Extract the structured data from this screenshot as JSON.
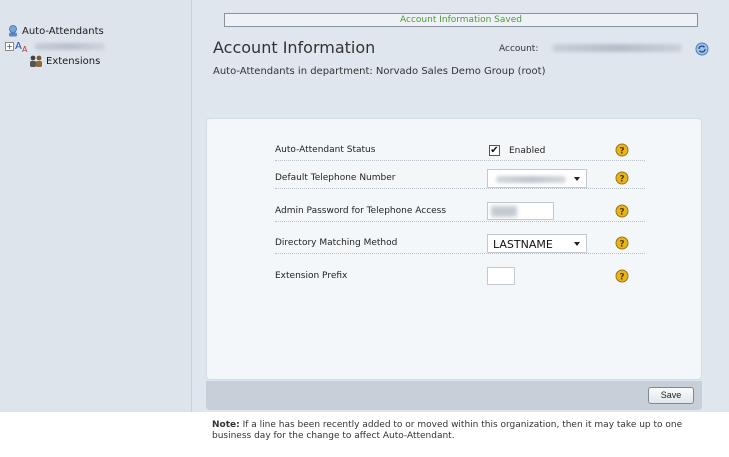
{
  "sidebar": {
    "root_label": "Auto-Attendants",
    "child_label": "Extensions"
  },
  "header": {
    "status_message": "Account Information Saved",
    "title": "Account Information",
    "account_label": "Account:",
    "subtitle": "Auto-Attendants in department: Norvado Sales Demo Group (root)"
  },
  "form": {
    "rows": [
      {
        "label": "Auto-Attendant Status",
        "control": "checkbox",
        "checked": true,
        "control_label": "Enabled"
      },
      {
        "label": "Default Telephone Number",
        "control": "select"
      },
      {
        "label": "Admin Password for Telephone Access",
        "control": "password"
      },
      {
        "label": "Directory Matching Method",
        "control": "select",
        "value": "LASTNAME"
      },
      {
        "label": "Extension Prefix",
        "control": "text",
        "value": ""
      }
    ],
    "checkbox_mark": "✔"
  },
  "footer": {
    "save_label": "Save"
  },
  "note": {
    "prefix": "Note:",
    "text": "If a line has been recently added to or moved within this organization, then it may take up to one business day for the change to affect Auto-Attendant."
  },
  "colors": {
    "status_green": "#4c9b36",
    "help_icon": "#e8b41c"
  },
  "icons": {
    "help": "question-circle-icon",
    "refresh": "refresh-icon",
    "tree_root": "attendant-icon",
    "tree_ext": "people-icon"
  }
}
